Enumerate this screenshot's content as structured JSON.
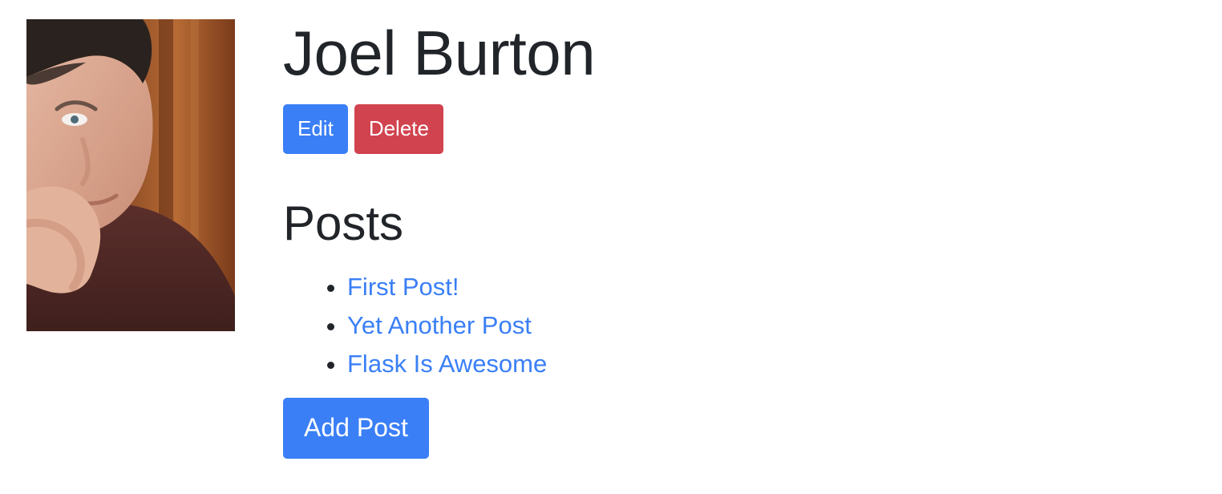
{
  "user": {
    "name": "Joel Burton",
    "photo_alt": "Joel Burton"
  },
  "actions": {
    "edit_label": "Edit",
    "delete_label": "Delete"
  },
  "posts_section": {
    "title": "Posts",
    "items": [
      {
        "title": "First Post!"
      },
      {
        "title": "Yet Another Post"
      },
      {
        "title": "Flask Is Awesome"
      }
    ],
    "add_label": "Add Post"
  },
  "colors": {
    "primary": "#3a7ff6",
    "danger": "#d1434f",
    "text": "#212529"
  }
}
